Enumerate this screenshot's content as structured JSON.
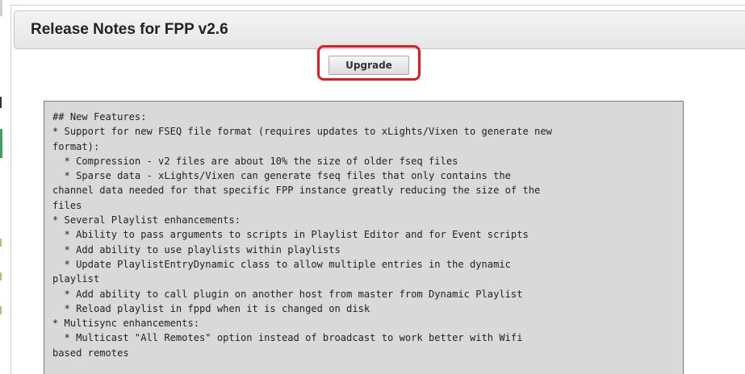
{
  "dialog": {
    "title": "Release Notes for FPP v2.6",
    "upgrade_label": "Upgrade"
  },
  "release_notes": {
    "lines": [
      "## New Features:",
      "* Support for new FSEQ file format (requires updates to xLights/Vixen to generate new",
      "format):",
      "  * Compression - v2 files are about 10% the size of older fseq files",
      "  * Sparse data - xLights/Vixen can generate fseq files that only contains the",
      "channel data needed for that specific FPP instance greatly reducing the size of the",
      "files",
      "* Several Playlist enhancements:",
      "  * Ability to pass arguments to scripts in Playlist Editor and for Event scripts",
      "  * Add ability to use playlists within playlists",
      "  * Update PlaylistEntryDynamic class to allow multiple entries in the dynamic",
      "playlist",
      "  * Add ability to call plugin on another host from master from Dynamic Playlist",
      "  * Reload playlist in fppd when it is changed on disk",
      "* Multisync enhancements:",
      "  * Multicast \"All Remotes\" option instead of broadcast to work better with Wifi",
      "based remotes"
    ]
  },
  "colors": {
    "highlight": "#e11b22",
    "notes_background": "#d9d9d9"
  }
}
